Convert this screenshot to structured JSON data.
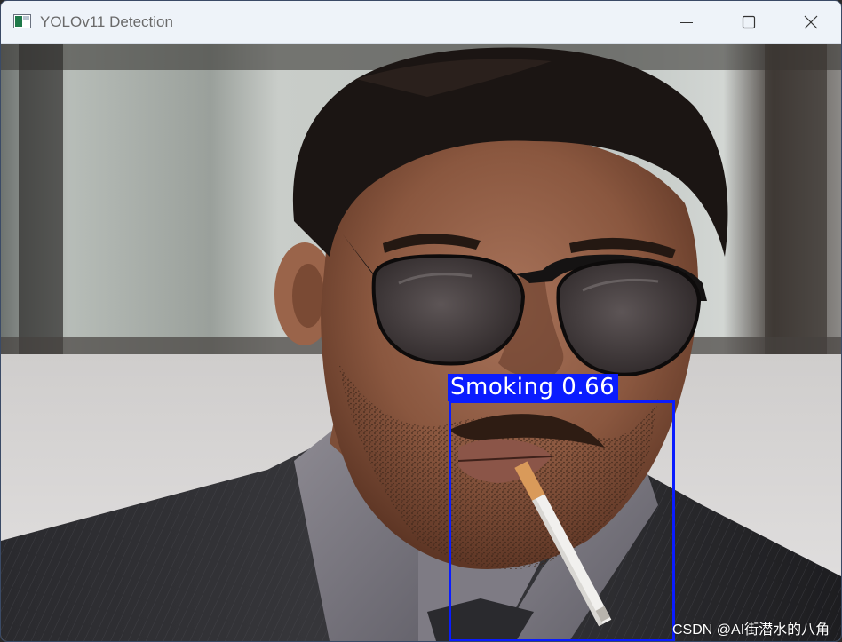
{
  "window": {
    "title": "YOLOv11 Detection"
  },
  "icons": {
    "app": "app-window-icon",
    "minimize": "minimize-icon",
    "maximize": "maximize-icon",
    "close": "close-icon"
  },
  "detection": {
    "class_label": "Smoking",
    "confidence": "0.66",
    "box_color": "#0a1cff"
  },
  "watermark": {
    "text": "CSDN @AI街潜水的八角"
  }
}
